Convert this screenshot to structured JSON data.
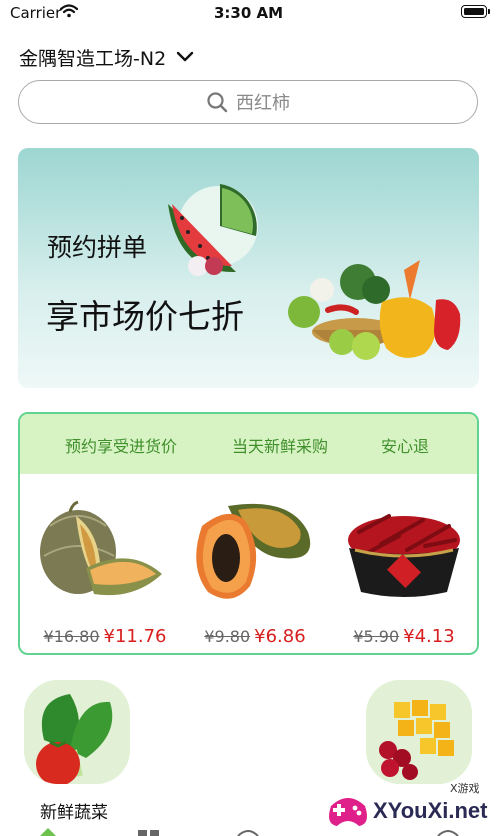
{
  "status_bar": {
    "carrier": "Carrier",
    "time": "3:30 AM"
  },
  "location": {
    "name": "金隅智造工场-N2"
  },
  "search": {
    "placeholder": "西红柿"
  },
  "banner": {
    "subtitle": "预约拼单",
    "title": "享市场价七折"
  },
  "promo": {
    "tabs": [
      "预约享受进货价",
      "当天新鲜采购",
      "安心退"
    ],
    "products": [
      {
        "name": "哈密瓜",
        "old_price": "¥16.80",
        "new_price": "¥11.76"
      },
      {
        "name": "木瓜",
        "old_price": "¥9.80",
        "new_price": "¥6.86"
      },
      {
        "name": "干辣椒",
        "old_price": "¥5.90",
        "new_price": "¥4.13"
      }
    ]
  },
  "categories": [
    {
      "label": "新鲜蔬菜"
    }
  ],
  "watermark": {
    "text": "XYouXi.net",
    "small": "X游戏"
  },
  "colors": {
    "accent_green": "#5fd38f",
    "price_red": "#d81e1e",
    "tab_bg": "#d8f3c3",
    "banner_bg": "#9dd6d2"
  }
}
